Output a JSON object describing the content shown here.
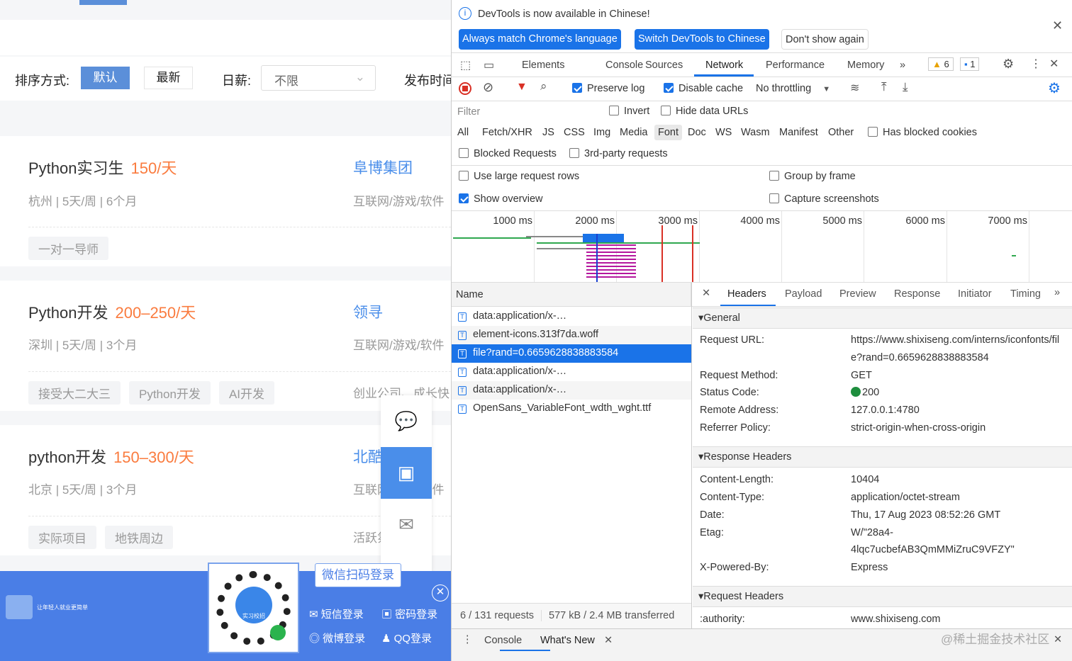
{
  "page": {
    "sort_label": "排序方式:",
    "sort_default": "默认",
    "sort_latest": "最新",
    "daily_label": "日薪:",
    "daily_value": "不限",
    "publish_label": "发布时间",
    "jobs": [
      {
        "title": "Python实习生",
        "salary": "150/天",
        "company": "阜博集团",
        "meta": "杭州 | 5天/周 | 6个月",
        "industry": "互联网/游戏/软件",
        "tags": [
          "一对一导师"
        ],
        "extra": ""
      },
      {
        "title": "Python开发",
        "salary": "200–250/天",
        "company": "领寻",
        "meta": "深圳 | 5天/周 | 3个月",
        "industry": "互联网/游戏/软件",
        "tags": [
          "接受大二大三",
          "Python开发",
          "AI开发"
        ],
        "extra": "创业公司、成长快"
      },
      {
        "title": "python开发",
        "salary": "150–300/天",
        "company": "北酷",
        "meta": "北京 | 5天/周 | 3个月",
        "industry": "互联网/游戏/软件",
        "tags": [
          "实际项目",
          "地铁周边"
        ],
        "extra": "活跃氛围，"
      }
    ],
    "login": {
      "slogan": "让年轻人就业更简单",
      "qr_label": "实习校招",
      "wechat_tip": "微信扫码登录",
      "sms": "短信登录",
      "password": "密码登录",
      "weibo": "微博登录",
      "qq": "QQ登录"
    }
  },
  "devtools": {
    "banner": {
      "text": "DevTools is now available in Chinese!",
      "btn1": "Always match Chrome's language",
      "btn2": "Switch DevTools to Chinese",
      "btn3": "Don't show again"
    },
    "tabs": [
      "Elements",
      "Console",
      "Sources",
      "Network",
      "Performance",
      "Memory"
    ],
    "warnings": "6",
    "messages": "1",
    "toolbar": {
      "preserve_log": "Preserve log",
      "disable_cache": "Disable cache",
      "throttling": "No throttling"
    },
    "filter": {
      "placeholder": "Filter",
      "invert": "Invert",
      "hide_data": "Hide data URLs",
      "types": [
        "All",
        "Fetch/XHR",
        "JS",
        "CSS",
        "Img",
        "Media",
        "Font",
        "Doc",
        "WS",
        "Wasm",
        "Manifest",
        "Other"
      ],
      "blocked_cookies": "Has blocked cookies",
      "blocked_requests": "Blocked Requests",
      "third_party": "3rd-party requests"
    },
    "options": {
      "large_rows": "Use large request rows",
      "group_frame": "Group by frame",
      "show_overview": "Show overview",
      "capture": "Capture screenshots"
    },
    "timeline": [
      "1000 ms",
      "2000 ms",
      "3000 ms",
      "4000 ms",
      "5000 ms",
      "6000 ms",
      "7000 ms"
    ],
    "name_header": "Name",
    "requests": [
      "data:application/x-…",
      "element-icons.313f7da.woff",
      "file?rand=0.6659628838883584",
      "data:application/x-…",
      "data:application/x-…",
      "OpenSans_VariableFont_wdth_wght.ttf"
    ],
    "detail_tabs": [
      "Headers",
      "Payload",
      "Preview",
      "Response",
      "Initiator",
      "Timing"
    ],
    "general": {
      "title": "General",
      "url_k": "Request URL:",
      "url_v1": "https://www.shixiseng.com/interns/iconfonts/fil",
      "url_v2": "e?rand=0.6659628838883584",
      "method_k": "Request Method:",
      "method_v": "GET",
      "status_k": "Status Code:",
      "status_v": "200",
      "remote_k": "Remote Address:",
      "remote_v": "127.0.0.1:4780",
      "ref_k": "Referrer Policy:",
      "ref_v": "strict-origin-when-cross-origin"
    },
    "response": {
      "title": "Response Headers",
      "cl_k": "Content-Length:",
      "cl_v": "10404",
      "ct_k": "Content-Type:",
      "ct_v": "application/octet-stream",
      "date_k": "Date:",
      "date_v": "Thu, 17 Aug 2023 08:52:26 GMT",
      "etag_k": "Etag:",
      "etag_v1": "W/\"28a4-",
      "etag_v2": "4lqc7ucbefAB3QmMMiZruC9VFZY\"",
      "xp_k": "X-Powered-By:",
      "xp_v": "Express"
    },
    "request": {
      "title": "Request Headers",
      "auth_k": ":authority:",
      "auth_v": "www.shixiseng.com"
    },
    "status": {
      "requests": "6 / 131 requests",
      "transferred": "577 kB / 2.4 MB transferred"
    },
    "drawer": {
      "console": "Console",
      "whats_new": "What's New"
    },
    "watermark": "@稀土掘金技术社区"
  }
}
